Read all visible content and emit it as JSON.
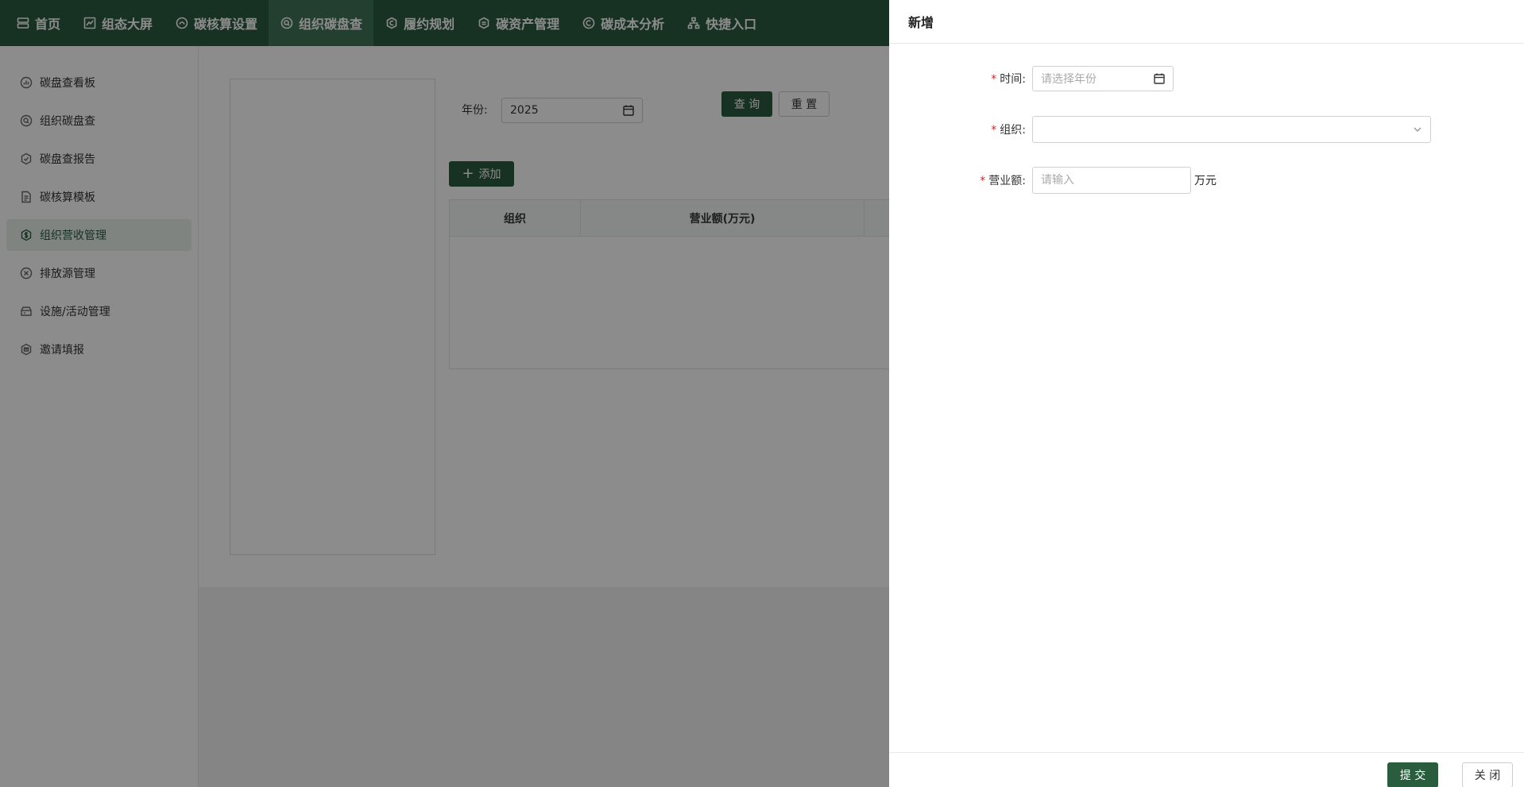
{
  "top_nav": {
    "items": [
      {
        "label": "首页",
        "icon": "server-icon"
      },
      {
        "label": "组态大屏",
        "icon": "chart-icon"
      },
      {
        "label": "碳核算设置",
        "icon": "carbon-icon"
      },
      {
        "label": "组织碳盘查",
        "icon": "search-icon"
      },
      {
        "label": "履约规划",
        "icon": "circle-c-icon"
      },
      {
        "label": "碳资产管理",
        "icon": "hexagon-icon"
      },
      {
        "label": "碳成本分析",
        "icon": "circle-c-icon"
      },
      {
        "label": "快捷入口",
        "icon": "sitemap-icon"
      }
    ],
    "active_index": 3
  },
  "sidebar": {
    "items": [
      {
        "label": "碳盘查看板",
        "icon": "dashboard-icon"
      },
      {
        "label": "组织碳盘查",
        "icon": "search-icon"
      },
      {
        "label": "碳盘查报告",
        "icon": "report-icon"
      },
      {
        "label": "碳核算模板",
        "icon": "document-icon"
      },
      {
        "label": "组织营收管理",
        "icon": "revenue-icon"
      },
      {
        "label": "排放源管理",
        "icon": "emission-icon"
      },
      {
        "label": "设施/活动管理",
        "icon": "facility-icon"
      },
      {
        "label": "邀请填报",
        "icon": "invite-icon"
      }
    ],
    "active_index": 4
  },
  "main": {
    "filter": {
      "year_label": "年份:",
      "year_value": "2025"
    },
    "query_label": "查 询",
    "reset_label": "重 置",
    "add_label": "添加",
    "table": {
      "columns": [
        "组织",
        "营业额(万元)"
      ]
    }
  },
  "drawer": {
    "title": "新增",
    "fields": {
      "time_label": "时间:",
      "time_placeholder": "请选择年份",
      "org_label": "组织:",
      "revenue_label": "营业额:",
      "revenue_placeholder": "请输入",
      "revenue_unit": "万元"
    },
    "submit_label": "提 交",
    "close_label": "关 闭"
  },
  "colors": {
    "primary": "#2a5c3e",
    "nav_active": "#3f7456",
    "required": "#e02020"
  }
}
